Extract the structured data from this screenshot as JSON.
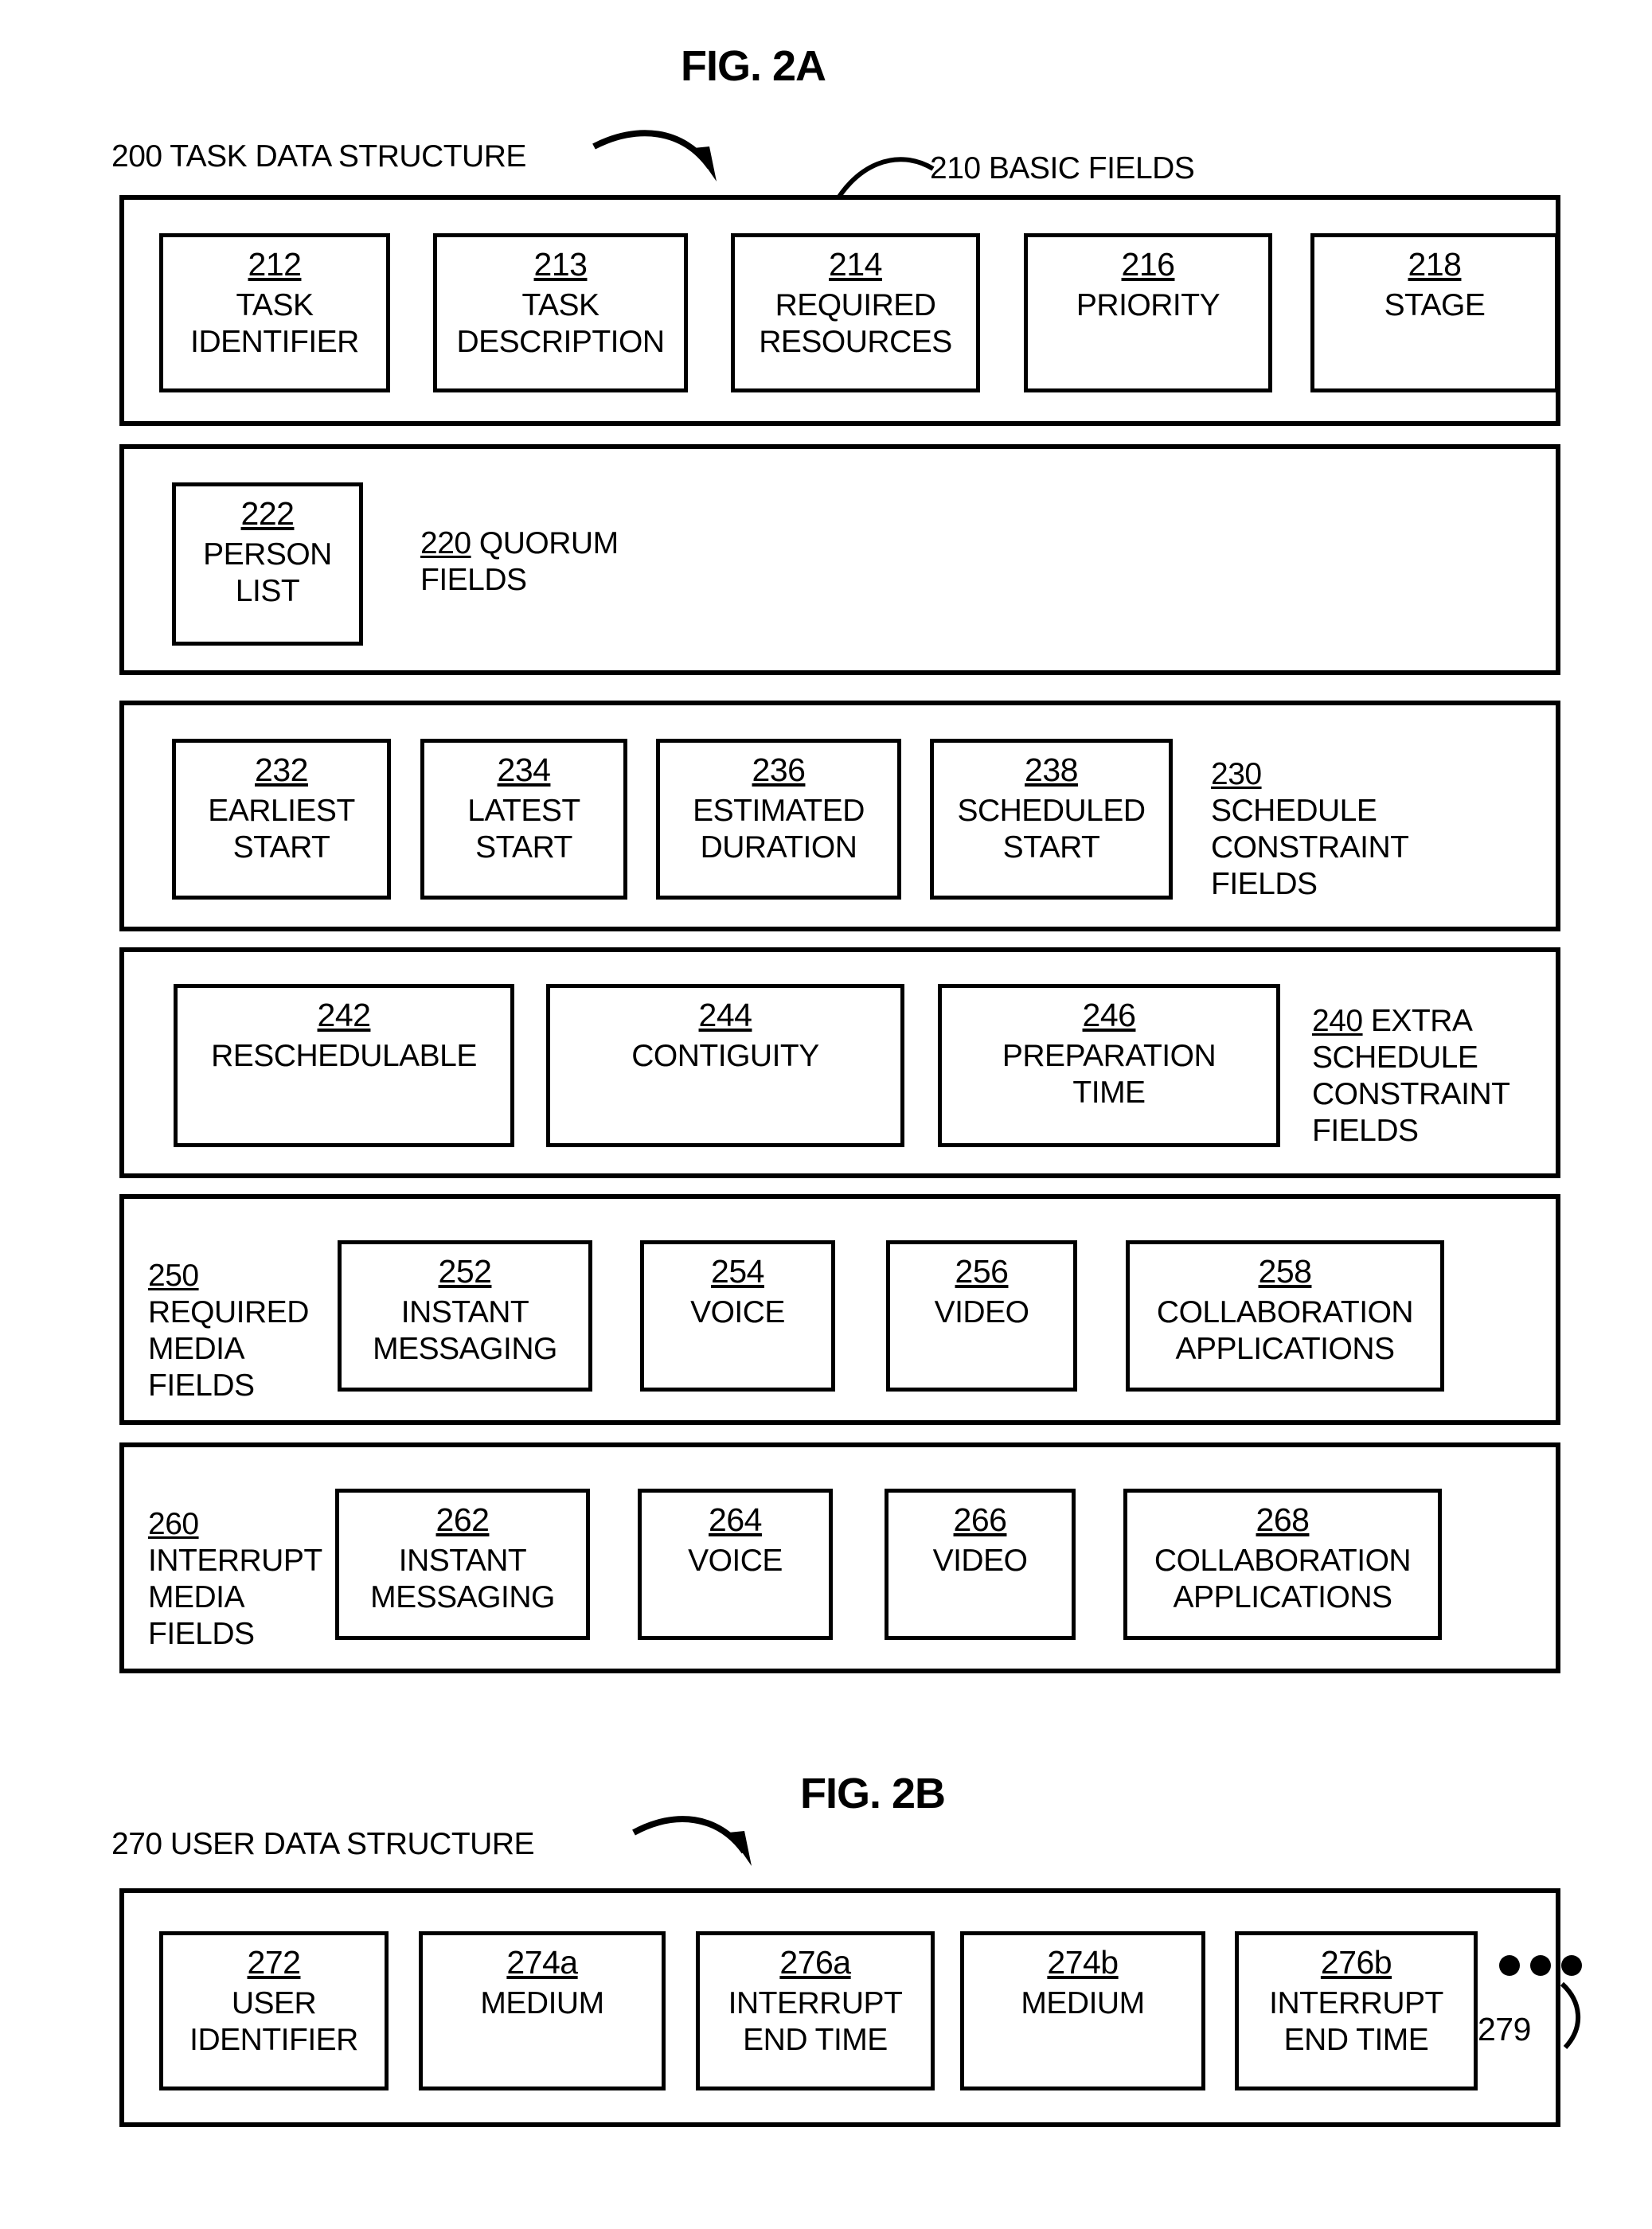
{
  "figures": {
    "fig2a": {
      "title": "FIG. 2A",
      "structure_label": "200 TASK DATA STRUCTURE",
      "basic_fields_callout": "210 BASIC FIELDS"
    },
    "fig2b": {
      "title": "FIG. 2B",
      "structure_label": "270 USER DATA STRUCTURE",
      "continuation_ref": "279"
    }
  },
  "groups": [
    {
      "id": "basic-fields",
      "num": "210",
      "title": "BASIC FIELDS",
      "title_inside": false,
      "fields": [
        {
          "num": "212",
          "label": "TASK\nIDENTIFIER"
        },
        {
          "num": "213",
          "label": "TASK\nDESCRIPTION"
        },
        {
          "num": "214",
          "label": "REQUIRED\nRESOURCES"
        },
        {
          "num": "216",
          "label": "PRIORITY"
        },
        {
          "num": "218",
          "label": "STAGE"
        }
      ]
    },
    {
      "id": "quorum-fields",
      "num": "220",
      "title": "QUORUM\nFIELDS",
      "title_inside": true,
      "fields": [
        {
          "num": "222",
          "label": "PERSON\nLIST"
        }
      ]
    },
    {
      "id": "schedule-constraint-fields",
      "num": "230",
      "title": "SCHEDULE\nCONSTRAINT\nFIELDS",
      "title_inside": true,
      "fields": [
        {
          "num": "232",
          "label": "EARLIEST\nSTART"
        },
        {
          "num": "234",
          "label": "LATEST\nSTART"
        },
        {
          "num": "236",
          "label": "ESTIMATED\nDURATION"
        },
        {
          "num": "238",
          "label": "SCHEDULED\nSTART"
        }
      ]
    },
    {
      "id": "extra-schedule-constraint-fields",
      "num": "240",
      "title": "EXTRA\nSCHEDULE\nCONSTRAINT\nFIELDS",
      "title_inside": true,
      "fields": [
        {
          "num": "242",
          "label": "RESCHEDULABLE"
        },
        {
          "num": "244",
          "label": "CONTIGUITY"
        },
        {
          "num": "246",
          "label": "PREPARATION\nTIME"
        }
      ]
    },
    {
      "id": "required-media-fields",
      "num": "250",
      "title": "REQUIRED\nMEDIA\nFIELDS",
      "title_inside": true,
      "fields": [
        {
          "num": "252",
          "label": "INSTANT\nMESSAGING"
        },
        {
          "num": "254",
          "label": "VOICE"
        },
        {
          "num": "256",
          "label": "VIDEO"
        },
        {
          "num": "258",
          "label": "COLLABORATION\nAPPLICATIONS"
        }
      ]
    },
    {
      "id": "interrupt-media-fields",
      "num": "260",
      "title": "INTERRUPT\nMEDIA\nFIELDS",
      "title_inside": true,
      "fields": [
        {
          "num": "262",
          "label": "INSTANT\nMESSAGING"
        },
        {
          "num": "264",
          "label": "VOICE"
        },
        {
          "num": "266",
          "label": "VIDEO"
        },
        {
          "num": "268",
          "label": "COLLABORATION\nAPPLICATIONS"
        }
      ]
    },
    {
      "id": "user-data-structure",
      "num": "270",
      "title": "",
      "title_inside": false,
      "fields": [
        {
          "num": "272",
          "label": "USER\nIDENTIFIER"
        },
        {
          "num": "274a",
          "label": "MEDIUM"
        },
        {
          "num": "276a",
          "label": "INTERRUPT\nEND TIME"
        },
        {
          "num": "274b",
          "label": "MEDIUM"
        },
        {
          "num": "276b",
          "label": "INTERRUPT\nEND TIME"
        }
      ]
    }
  ],
  "colors": {
    "ink": "#000000",
    "paper": "#ffffff"
  }
}
